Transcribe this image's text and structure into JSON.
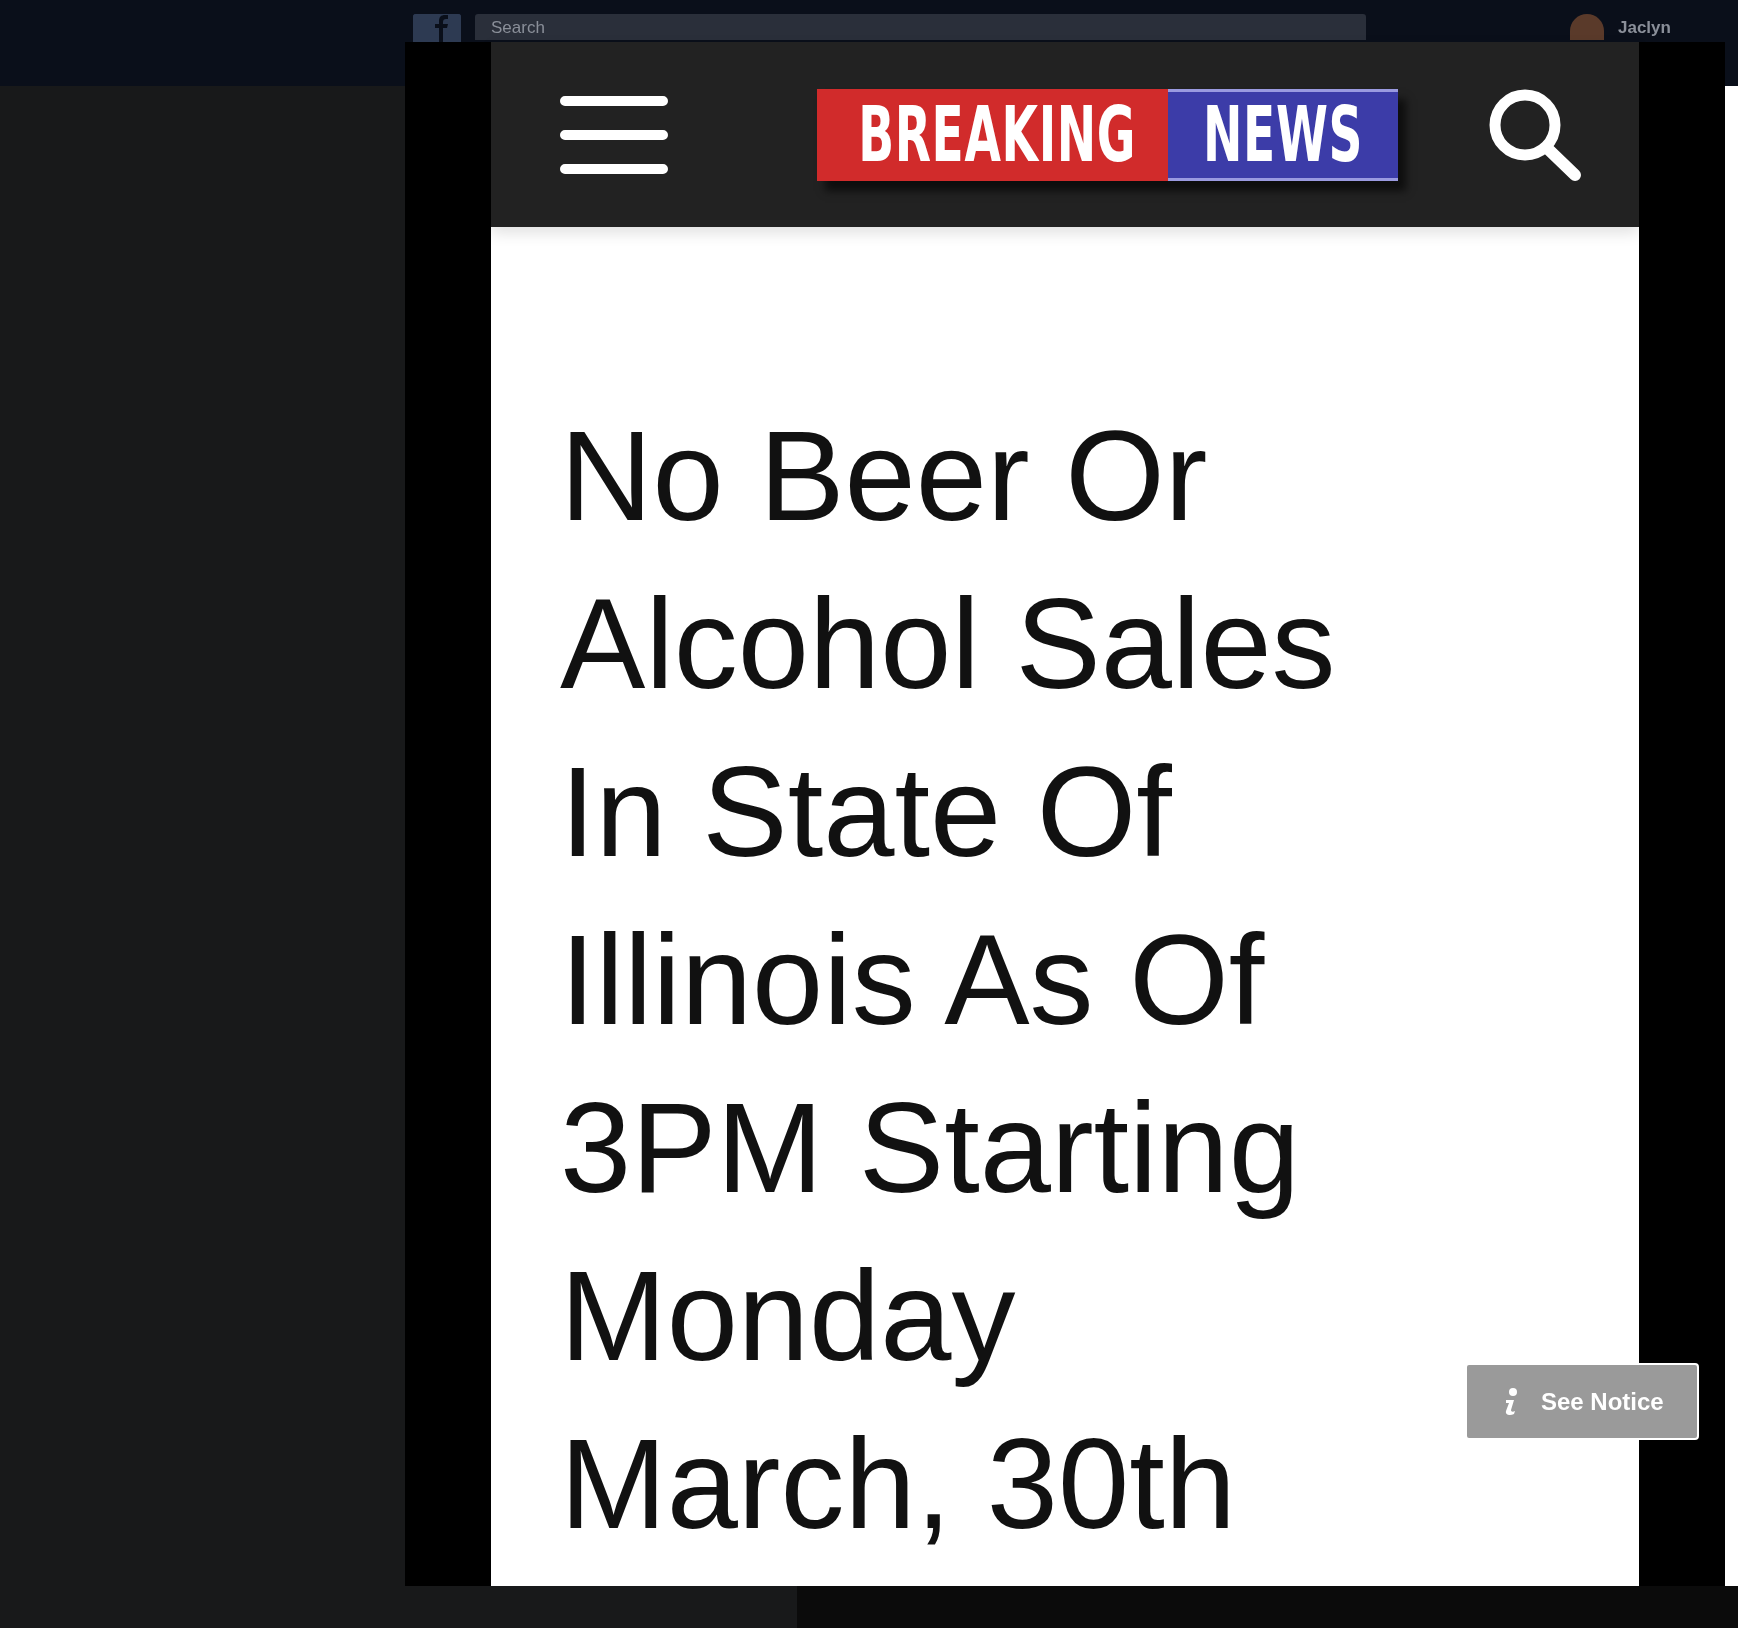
{
  "top_bar": {
    "search": {
      "placeholder": "Search"
    },
    "user_name": "Jaclyn"
  },
  "news_site": {
    "logo": {
      "left_word": "BREAKING",
      "right_word": "NEWS"
    },
    "headline": "No Beer Or Alcohol Sales In State Of Illinois As Of 3PM Starting Monday March, 30th"
  },
  "notice_button": {
    "label": "See Notice"
  }
}
